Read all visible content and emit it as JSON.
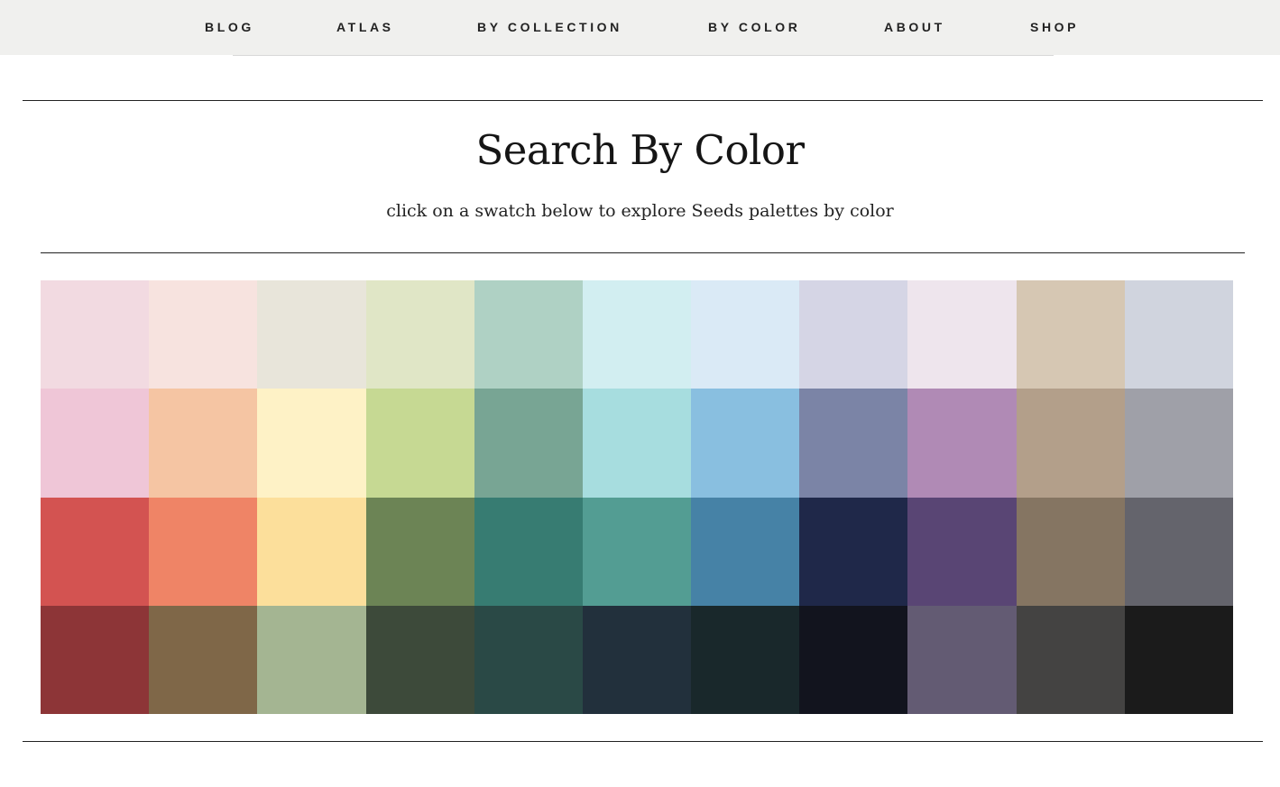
{
  "nav": {
    "items": [
      {
        "label": "BLOG"
      },
      {
        "label": "ATLAS"
      },
      {
        "label": "BY COLLECTION"
      },
      {
        "label": "BY COLOR"
      },
      {
        "label": "ABOUT"
      },
      {
        "label": "SHOP"
      }
    ]
  },
  "header": {
    "title": "Search By Color",
    "subtitle": "click on a swatch below to explore Seeds palettes by color"
  },
  "swatches": {
    "rows": [
      [
        "#f2dae1",
        "#f7e3df",
        "#e8e5da",
        "#e0e6c6",
        "#afd1c4",
        "#d2eef1",
        "#daeaf6",
        "#d5d5e5",
        "#eee5ed",
        "#d6c7b3",
        "#d0d4de"
      ],
      [
        "#efc6d7",
        "#f5c5a3",
        "#fef2c6",
        "#c6d993",
        "#78a594",
        "#a7dddf",
        "#89bfe0",
        "#7b84a6",
        "#b08ab5",
        "#b39f8a",
        "#9fa0a8"
      ],
      [
        "#d35351",
        "#ef8466",
        "#fcdf9b",
        "#6c8455",
        "#377c72",
        "#539d93",
        "#4682a6",
        "#1f2849",
        "#594574",
        "#857562",
        "#64646c"
      ],
      [
        "#8d3537",
        "#7f6748",
        "#a4b592",
        "#3d4a3a",
        "#2a4946",
        "#22303c",
        "#19282b",
        "#12141e",
        "#635b73",
        "#444342",
        "#1b1b1b"
      ]
    ]
  }
}
